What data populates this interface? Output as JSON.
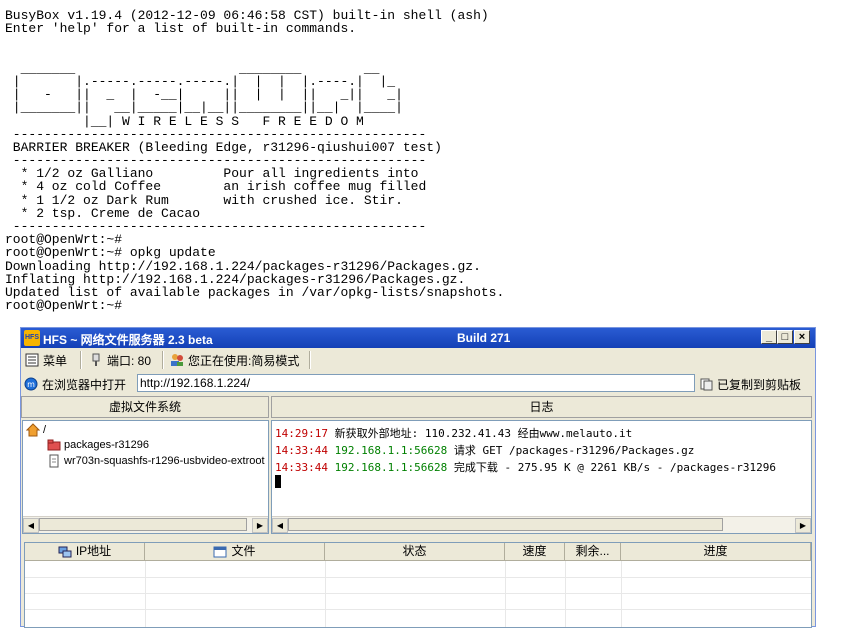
{
  "terminal": {
    "lines": [
      "BusyBox v1.19.4 (2012-12-09 06:46:58 CST) built-in shell (ash)",
      "Enter 'help' for a list of built-in commands.",
      "",
      "",
      "  _______                     ________        __",
      " |       |.-----.-----.-----.|  |  |  |.----.|  |_",
      " |   -   ||  _  |  -__|     ||  |  |  ||   _||   _|",
      " |_______||   __|_____|__|__||________||__|  |____|",
      "          |__| W I R E L E S S   F R E E D O M",
      " -----------------------------------------------------",
      " BARRIER BREAKER (Bleeding Edge, r31296-qiushui007 test)",
      " -----------------------------------------------------",
      "  * 1/2 oz Galliano         Pour all ingredients into",
      "  * 4 oz cold Coffee        an irish coffee mug filled",
      "  * 1 1/2 oz Dark Rum       with crushed ice. Stir.",
      "  * 2 tsp. Creme de Cacao",
      " -----------------------------------------------------",
      "root@OpenWrt:~#",
      "root@OpenWrt:~# opkg update",
      "Downloading http://192.168.1.224/packages-r31296/Packages.gz.",
      "Inflating http://192.168.1.224/packages-r31296/Packages.gz.",
      "Updated list of available packages in /var/opkg-lists/snapshots.",
      "root@OpenWrt:~#"
    ]
  },
  "window": {
    "title": "HFS ~ 网络文件服务器 2.3 beta",
    "build": "Build 271",
    "logo_text": "HFS",
    "min_label": "_",
    "max_label": "□",
    "close_label": "×"
  },
  "menubar": {
    "menu_label": "菜单",
    "port_label": "端口: 80",
    "mode_label": "您正在使用:简易模式"
  },
  "urlbar": {
    "open_label": "在浏览器中打开",
    "url": "http://192.168.1.224/",
    "copy_label": "已复制到剪贴板"
  },
  "vfs": {
    "header": "虚拟文件系统",
    "root": "/",
    "items": [
      "packages-r31296",
      "wr703n-squashfs-r1296-usbvideo-extroot"
    ]
  },
  "log": {
    "header": "日志",
    "entries": [
      {
        "time": "14:29:17",
        "source": "",
        "text": "新获取外部地址: 110.232.41.43 经由www.melauto.it"
      },
      {
        "time": "14:33:44",
        "source": "192.168.1.1:56628",
        "text": "请求 GET /packages-r31296/Packages.gz"
      },
      {
        "time": "14:33:44",
        "source": "192.168.1.1:56628",
        "text": "完成下载 - 275.95 K @ 2261 KB/s - /packages-r31296"
      }
    ]
  },
  "connections": {
    "columns": [
      "IP地址",
      "文件",
      "状态",
      "速度",
      "剩余...",
      "进度"
    ]
  },
  "colors": {
    "log_time": "#c00000",
    "log_source": "#008000",
    "titlebar": "#1440b6"
  }
}
